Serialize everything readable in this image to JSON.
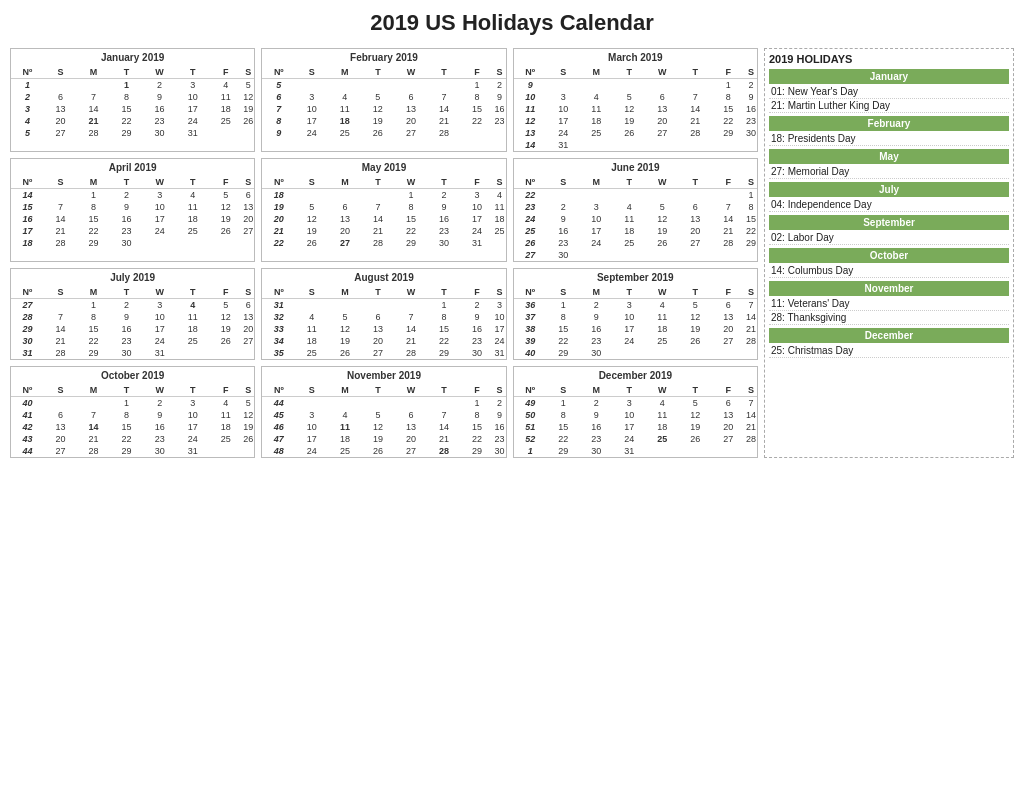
{
  "title": "2019 US Holidays Calendar",
  "holidays_panel": {
    "heading": "2019 HOLIDAYS",
    "months": [
      {
        "name": "January",
        "items": [
          "01: New Year's Day",
          "21: Martin Luther King Day"
        ]
      },
      {
        "name": "February",
        "items": [
          "18: Presidents Day"
        ]
      },
      {
        "name": "May",
        "items": [
          "27: Memorial Day"
        ]
      },
      {
        "name": "July",
        "items": [
          "04: Independence Day"
        ]
      },
      {
        "name": "September",
        "items": [
          "02: Labor Day"
        ]
      },
      {
        "name": "October",
        "items": [
          "14: Columbus Day"
        ]
      },
      {
        "name": "November",
        "items": [
          "11: Veterans' Day",
          "28: Thanksgiving"
        ]
      },
      {
        "name": "December",
        "items": [
          "25: Christmas Day"
        ]
      }
    ]
  }
}
